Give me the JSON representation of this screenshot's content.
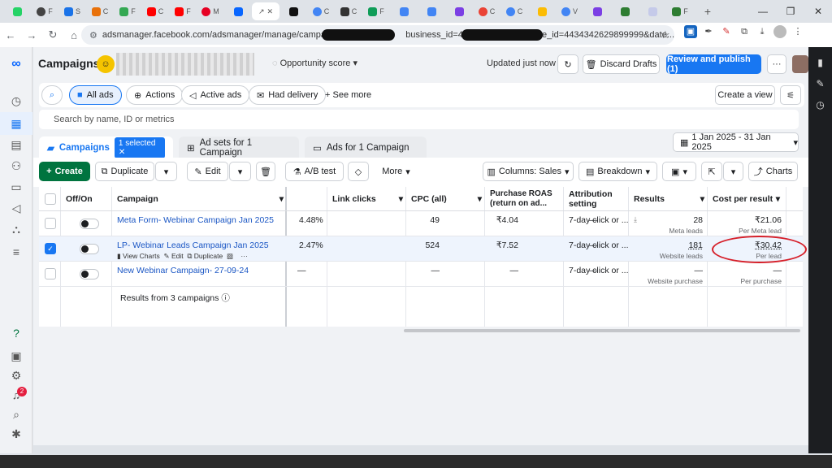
{
  "browser": {
    "url_prefix": "adsmanager.facebook.com/adsmanager/manage/campaigns?act=199",
    "url_mid": "business_id=443",
    "url_tail": "obal_scope_id=4434342629899999&date...",
    "tab_labels": [
      "",
      "F",
      "S",
      "C",
      "F",
      "C",
      "F",
      "M",
      "",
      "",
      "",
      "C",
      "C",
      "F",
      "",
      "",
      "",
      "C",
      "C",
      "",
      "V",
      "",
      "",
      "F"
    ]
  },
  "header": {
    "title": "Campaigns",
    "opportunity": "Opportunity score",
    "updated": "Updated just now",
    "discard": "Discard Drafts",
    "review": "Review and publish (1)",
    "more": "···"
  },
  "filters": {
    "all_ads": "All ads",
    "actions": "Actions",
    "active_ads": "Active ads",
    "had_delivery": "Had delivery",
    "see_more": "See more",
    "create_view": "Create a view"
  },
  "search": {
    "placeholder": "Search by name, ID or metrics"
  },
  "entity_tabs": {
    "campaigns": "Campaigns",
    "selected": "1 selected",
    "adsets": "Ad sets for 1 Campaign",
    "ads": "Ads for 1 Campaign"
  },
  "date_range": "1 Jan 2025 - 31 Jan 2025",
  "toolbar": {
    "create": "Create",
    "duplicate": "Duplicate",
    "edit": "Edit",
    "ab_test": "A/B test",
    "more": "More",
    "columns": "Columns: Sales",
    "breakdown": "Breakdown",
    "charts": "Charts"
  },
  "columns": {
    "offon": "Off/On",
    "campaign": "Campaign",
    "link_clicks": "Link clicks",
    "cpc": "CPC (all)",
    "roas": "Purchase ROAS (return on ad...",
    "attribution": "Attribution setting",
    "results": "Results",
    "cost": "Cost per result"
  },
  "rows": [
    {
      "name": "Meta Form- Webinar Campaign Jan 2025",
      "ctr": "4.48%",
      "clicks": "49",
      "cpc": "₹4.04",
      "roas": "—",
      "attr": "7-day click or ...",
      "results": "28",
      "results_sub": "Meta leads",
      "cost": "₹21.06",
      "cost_sub": "Per Meta lead"
    },
    {
      "name": "LP- Webinar Leads Campaign Jan 2025",
      "ctr": "2.47%",
      "clicks": "524",
      "cpc": "₹7.52",
      "roas": "—",
      "attr": "7-day click or ...",
      "results": "181",
      "results_sub": "Website leads",
      "cost": "₹30.42",
      "cost_sub": "Per lead",
      "actions": {
        "view_charts": "View Charts",
        "edit": "Edit",
        "duplicate": "Duplicate",
        "more": "···"
      }
    },
    {
      "name": "New Webinar Campaign- 27-09-24",
      "ctr": "—",
      "clicks": "—",
      "cpc": "—",
      "roas": "—",
      "attr": "7-day click or ...",
      "results": "—",
      "results_sub": "Website purchase",
      "cost": "—",
      "cost_sub": "Per purchase"
    }
  ],
  "summary": "Results from 3 campaigns",
  "notifications": "2",
  "colors": {
    "accent": "#1877f2",
    "create": "#00743f",
    "annotation": "#d6202a"
  }
}
